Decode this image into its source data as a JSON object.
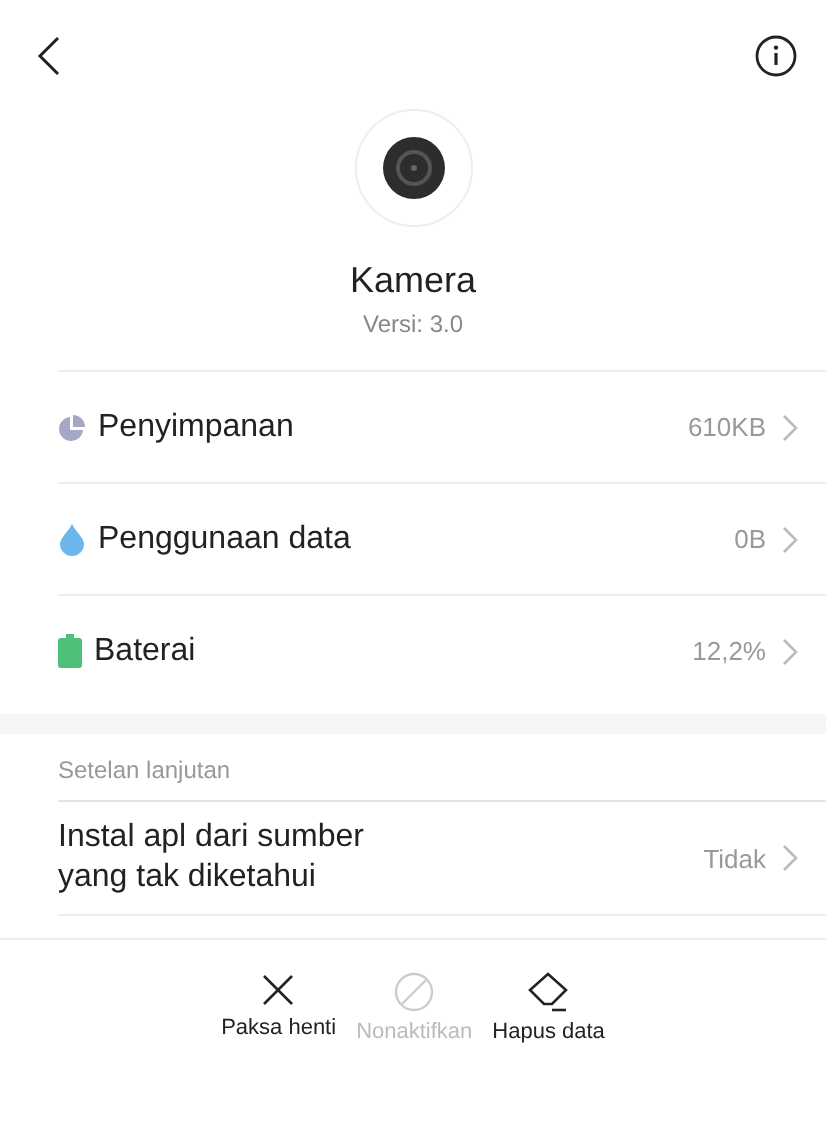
{
  "app": {
    "name": "Kamera",
    "version": "Versi: 3.0"
  },
  "items": [
    {
      "kind": "storage",
      "label": "Penyimpanan",
      "value": "610KB"
    },
    {
      "kind": "data",
      "label": "Penggunaan data",
      "value": "0B"
    },
    {
      "kind": "battery",
      "label": "Baterai",
      "value": "12,2%"
    }
  ],
  "advanced": {
    "header": "Setelan lanjutan",
    "items": [
      {
        "label": "Instal apl dari sumber",
        "label_line_2": "yang tak diketahui",
        "value": "Tidak"
      }
    ]
  },
  "actions": [
    {
      "kind": "stop",
      "label": "Paksa henti",
      "disabled": false
    },
    {
      "kind": "disable",
      "label": "Nonaktifkan",
      "disabled": true
    },
    {
      "kind": "clear",
      "label": "Hapus data",
      "disabled": false
    }
  ]
}
